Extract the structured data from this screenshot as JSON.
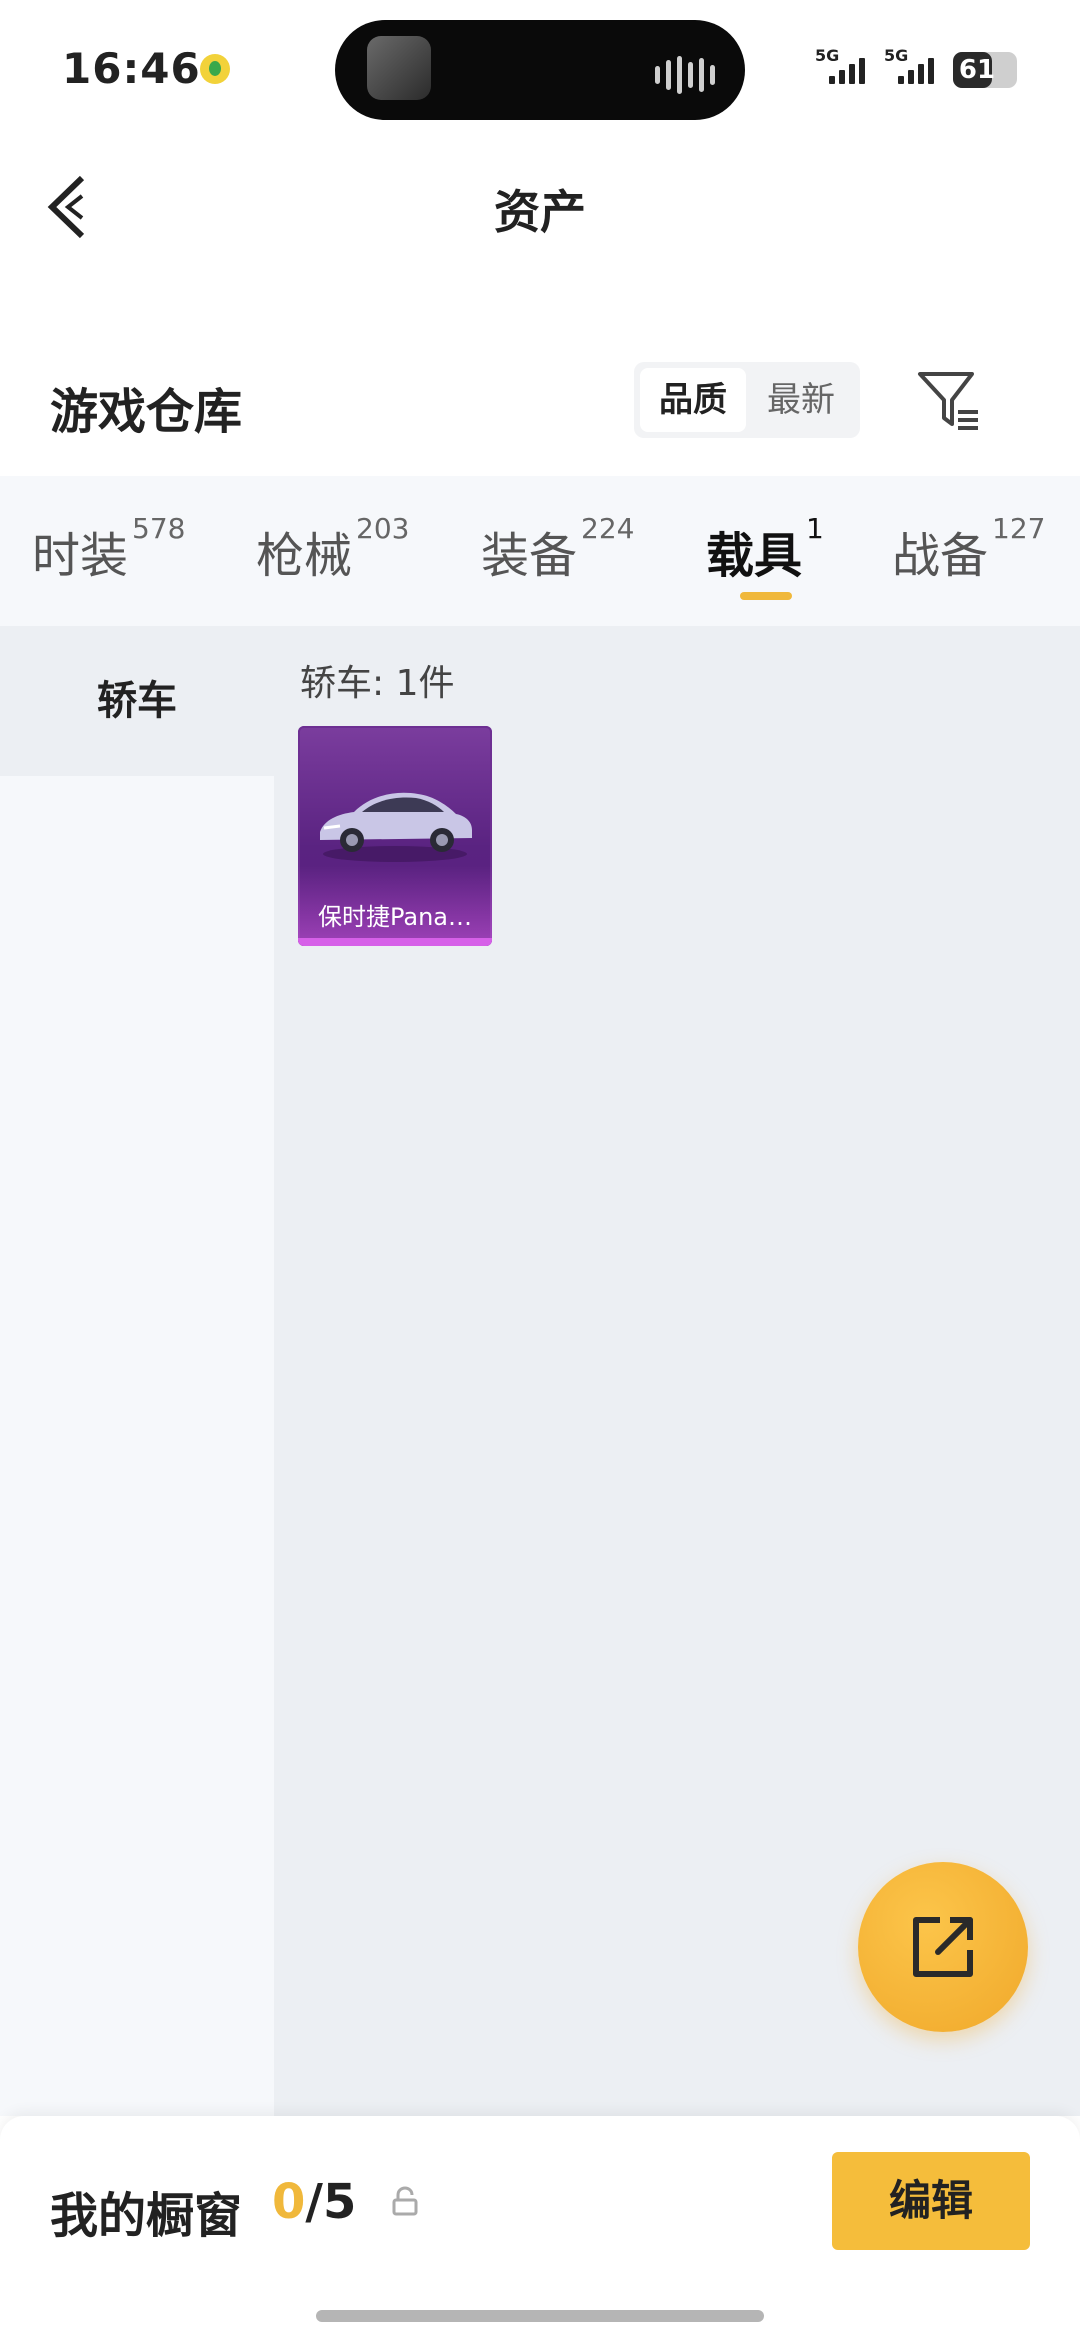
{
  "status_bar": {
    "time": "16:46",
    "signal_1_label": "5G",
    "signal_2_label": "5G",
    "battery_level": "61"
  },
  "header": {
    "title": "资产",
    "back_icon": "chevron-left-icon"
  },
  "warehouse": {
    "title": "游戏仓库",
    "sort_options": [
      "品质",
      "最新"
    ],
    "sort_selected": "品质",
    "filter_icon": "filter-icon"
  },
  "tabs": [
    {
      "label": "时装",
      "count": "578"
    },
    {
      "label": "枪械",
      "count": "203"
    },
    {
      "label": "装备",
      "count": "224"
    },
    {
      "label": "载具",
      "count": "1",
      "active": true
    },
    {
      "label": "战备",
      "count": "127"
    }
  ],
  "sidebar": {
    "items": [
      {
        "label": "轿车",
        "selected": true
      }
    ]
  },
  "content": {
    "section_label": "轿车: 1件",
    "items": [
      {
        "name": "保时捷Pana…",
        "rarity_color": "#5a2381"
      }
    ]
  },
  "showcase": {
    "title": "我的橱窗",
    "current": "0",
    "separator_total": "/5",
    "edit_label": "编辑"
  },
  "colors": {
    "accent": "#f5bd3b",
    "tab_underline": "#f0b83b",
    "rarity_purple": "#5a2381"
  }
}
